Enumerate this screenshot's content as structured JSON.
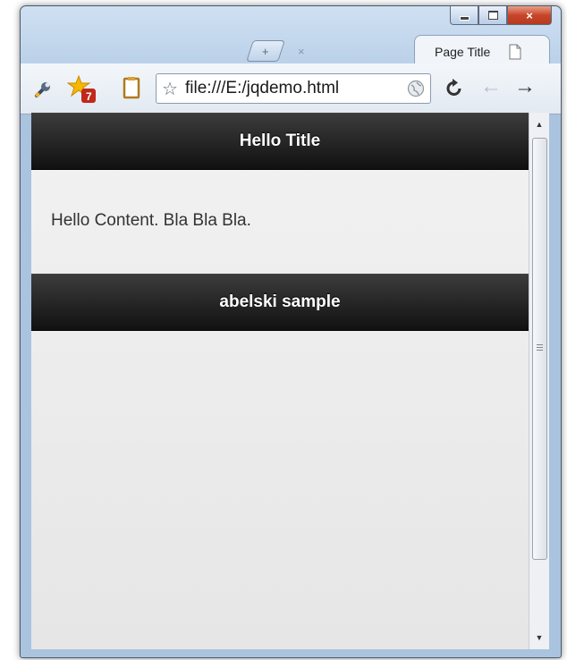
{
  "window": {
    "controls": {
      "minimize": "",
      "maximize": "",
      "close": "×"
    }
  },
  "tabs": {
    "new_tab_label": "+",
    "close_glyph": "×",
    "active_tab_title": "Page Title"
  },
  "toolbar": {
    "address_value": "file:///E:/jqdemo.html",
    "extension_badge": "7",
    "icons": [
      "wrench-icon",
      "extension-star-icon",
      "clipboard-icon",
      "bookmark-star-icon",
      "globe-icon",
      "reload-icon",
      "back-arrow-icon",
      "forward-arrow-icon"
    ]
  },
  "page": {
    "header_title": "Hello Title",
    "content": "Hello Content. Bla Bla Bla.",
    "footer_title": "abelski sample"
  },
  "colors": {
    "bar_top": "#3c3c3c",
    "bar_bottom": "#111111",
    "page_bg": "#efefef"
  }
}
